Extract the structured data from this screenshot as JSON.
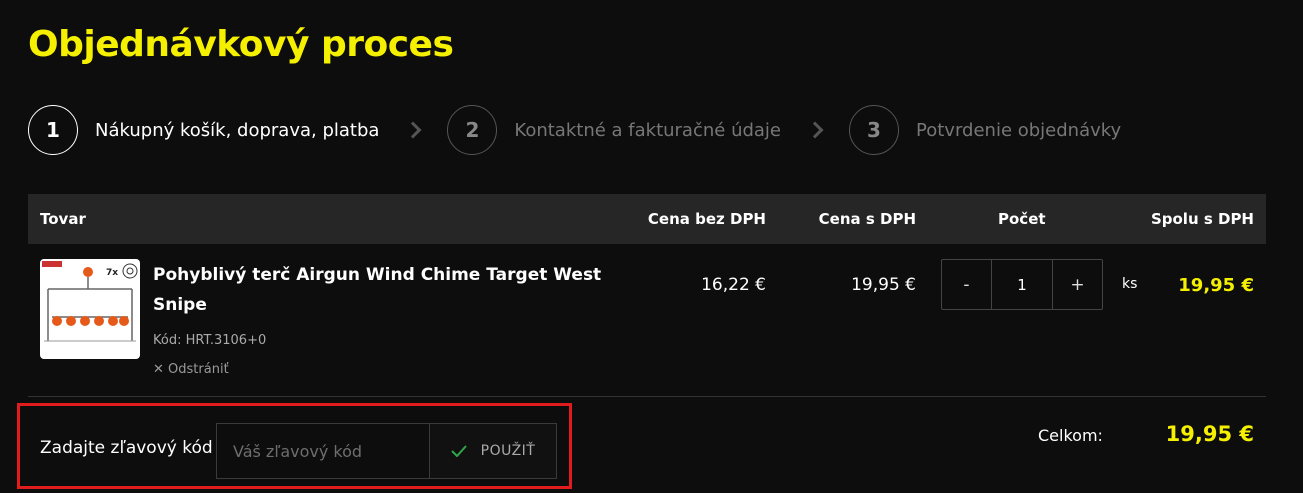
{
  "title": "Objednávkový proces",
  "steps": [
    {
      "number": "1",
      "label": "Nákupný košík, doprava, platba"
    },
    {
      "number": "2",
      "label": "Kontaktné a fakturačné údaje"
    },
    {
      "number": "3",
      "label": "Potvrdenie objednávky"
    }
  ],
  "table": {
    "headers": {
      "product": "Tovar",
      "price_ex_vat": "Cena bez DPH",
      "price_inc_vat": "Cena s DPH",
      "quantity": "Počet",
      "total_inc_vat": "Spolu s DPH"
    }
  },
  "item": {
    "name": "Pohyblivý terč Airgun Wind Chime Target West Snipe",
    "code": "Kód: HRT.3106+0",
    "remove_label": "Odstrániť",
    "price_ex_vat": "16,22 €",
    "price_inc_vat": "19,95 €",
    "qty_minus": "-",
    "qty_value": "1",
    "qty_plus": "+",
    "unit": "ks",
    "line_total": "19,95 €",
    "thumb_text": "7x"
  },
  "coupon": {
    "label": "Zadajte zľavový kód",
    "placeholder": "Váš zľavový kód",
    "apply_label": "POUŽIŤ"
  },
  "summary": {
    "total_label": "Celkom:",
    "total_value": "19,95 €"
  },
  "colors": {
    "accent": "#f5f000",
    "highlight_border": "#e21c1c",
    "check": "#2ea84a"
  }
}
